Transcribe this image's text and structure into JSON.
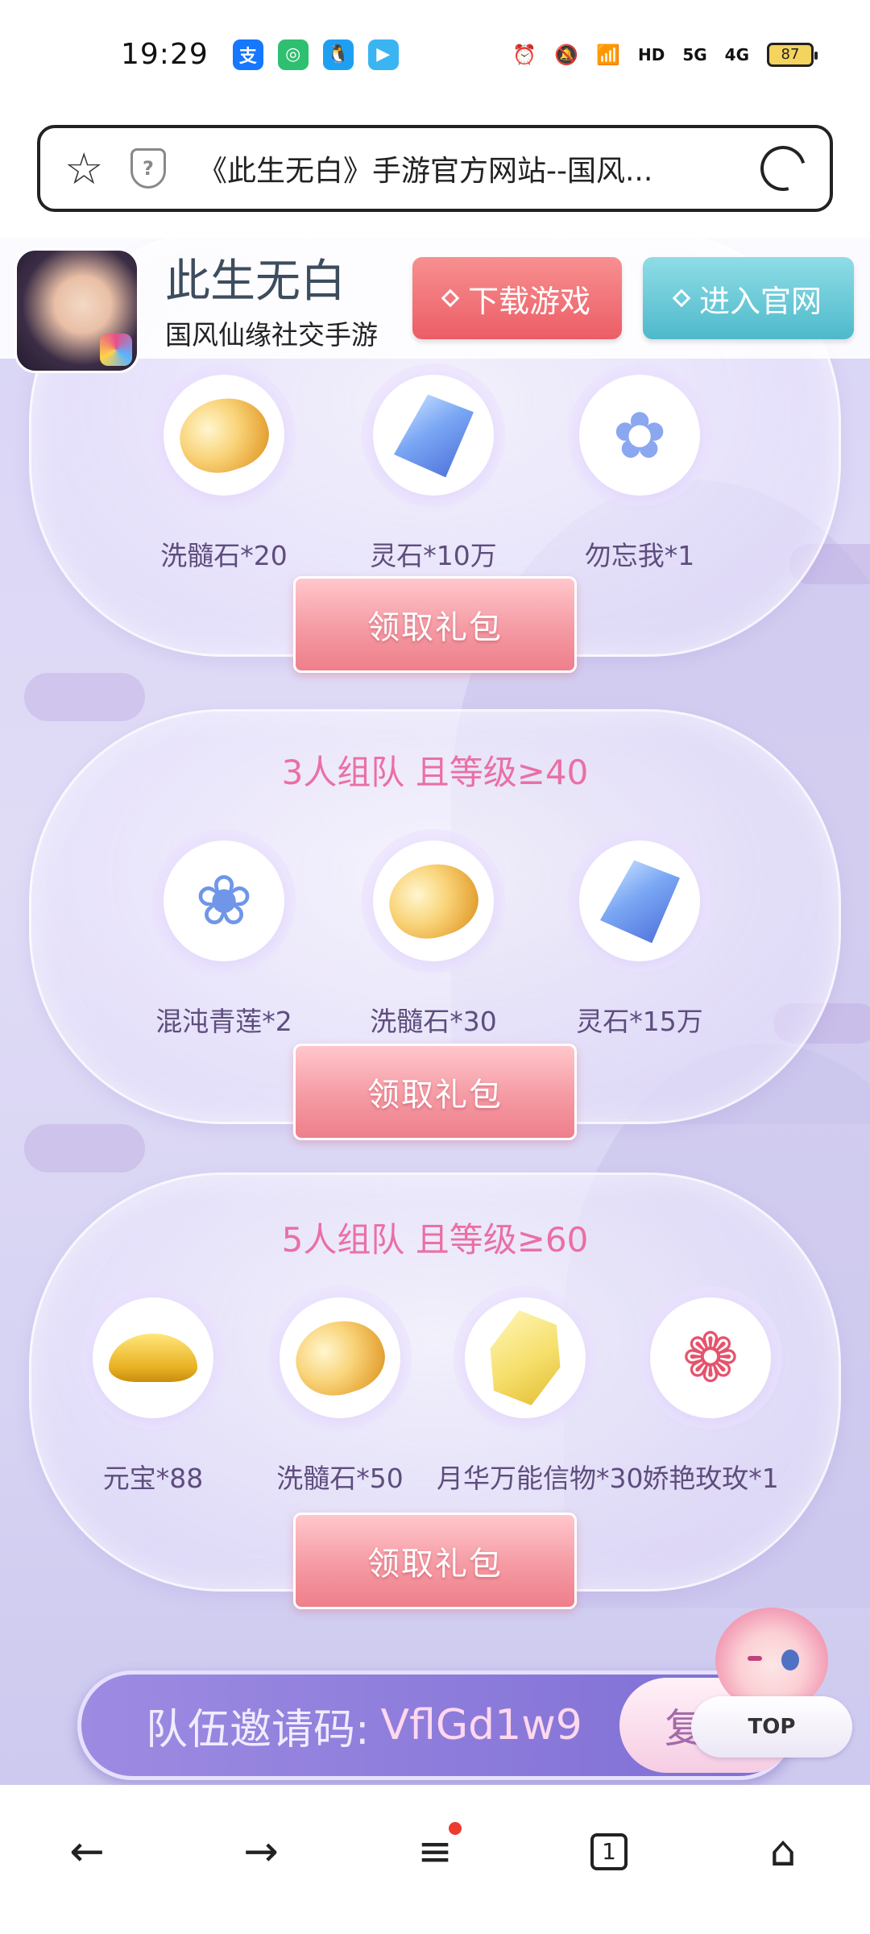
{
  "status_bar": {
    "time": "19:29",
    "apps": [
      {
        "icon": "alipay-icon",
        "glyph": "支",
        "color": "#1677ff"
      },
      {
        "icon": "app-green-icon",
        "glyph": "◎",
        "color": "#2fbf71"
      },
      {
        "icon": "qq-icon",
        "glyph": "🐧",
        "color": "#1ea0f2"
      },
      {
        "icon": "video-play-icon",
        "glyph": "▶",
        "color": "#3bb4f2"
      }
    ],
    "signal_5g": "5G",
    "signal_4g": "4G",
    "hd": "HD",
    "battery": "87"
  },
  "browser": {
    "url_title": "《此生无白》手游官方网站--国风..."
  },
  "header": {
    "game_name": "此生无白",
    "game_subtitle": "国风仙缘社交手游",
    "download_label": "下载游戏",
    "official_label": "进入官网",
    "download_color": "#ec5d66",
    "official_color": "#4eb9cb"
  },
  "panels": [
    {
      "title": "",
      "rewards": [
        {
          "icon": "marrow-stone-icon",
          "label": "洗髓石*20"
        },
        {
          "icon": "spirit-stone-icon",
          "label": "灵石*10万"
        },
        {
          "icon": "forget-me-not-icon",
          "label": "勿忘我*1"
        }
      ],
      "button": "领取礼包"
    },
    {
      "title": "3人组队 且等级≥40",
      "rewards": [
        {
          "icon": "chaos-lotus-icon",
          "label": "混沌青莲*2"
        },
        {
          "icon": "marrow-stone-icon",
          "label": "洗髓石*30"
        },
        {
          "icon": "spirit-stone-icon",
          "label": "灵石*15万"
        }
      ],
      "button": "领取礼包"
    },
    {
      "title": "5人组队 且等级≥60",
      "rewards": [
        {
          "icon": "gold-ingot-icon",
          "label": "元宝*88"
        },
        {
          "icon": "marrow-stone-icon",
          "label": "洗髓石*50"
        },
        {
          "icon": "moon-token-icon",
          "label": "月华万能信物*30"
        },
        {
          "icon": "rose-icon",
          "label": "娇艳玫玫*1"
        }
      ],
      "button": "领取礼包"
    }
  ],
  "invite": {
    "label": "队伍邀请码:",
    "code": "VflGd1w9",
    "copy_label": "复"
  },
  "mascot": {
    "top_label": "TOP"
  },
  "nav": {
    "tab_count": "1"
  }
}
